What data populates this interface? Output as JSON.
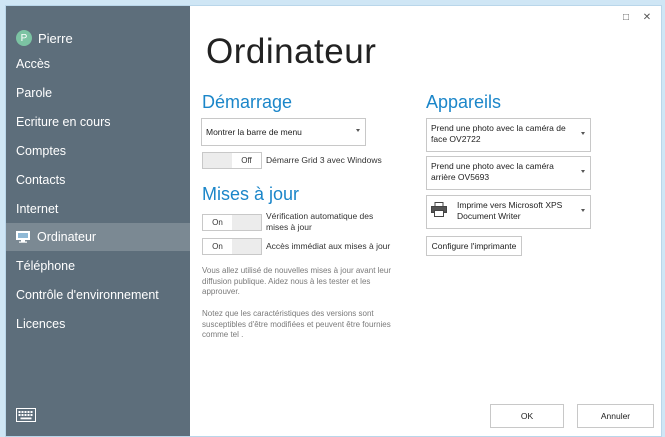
{
  "user": {
    "initial": "P",
    "name": "Pierre"
  },
  "sidebar": {
    "items": [
      {
        "label": "Accès"
      },
      {
        "label": "Parole"
      },
      {
        "label": "Ecriture en cours"
      },
      {
        "label": "Comptes"
      },
      {
        "label": "Contacts"
      },
      {
        "label": "Internet"
      },
      {
        "label": "Ordinateur",
        "active": true,
        "icon": "monitor-icon"
      },
      {
        "label": "Téléphone"
      },
      {
        "label": "Contrôle d'environnement"
      },
      {
        "label": "Licences"
      }
    ],
    "bottom_icon": "keyboard-icon"
  },
  "window_controls": {
    "maximize": "□",
    "close": "✕"
  },
  "page": {
    "title": "Ordinateur"
  },
  "startup": {
    "title": "Démarrage",
    "menu_dropdown": "Montrer la barre de menu",
    "toggle": {
      "on": "",
      "off": "Off"
    },
    "toggle_label": "Démarre Grid 3 avec Windows"
  },
  "updates": {
    "title": "Mises à jour",
    "auto_check": {
      "on": "On",
      "label": "Vérification automatique des mises à jour"
    },
    "immediate": {
      "on": "On",
      "label": "Accès immédiat aux mises à jour"
    },
    "note1": "Vous allez utilisé de nouvelles mises à jour avant leur diffusion publique. Aidez nous à  les tester et les approuver.",
    "note2": "Notez que les caractéristiques des versions sont susceptibles d'être modifiées et peuvent être fournies comme tel ."
  },
  "devices": {
    "title": "Appareils",
    "front_camera": "Prend une photo avec la caméra de face OV2722",
    "rear_camera": "Prend une photo avec la caméra arrière OV5693",
    "printer": "Imprime vers Microsoft XPS Document Writer",
    "configure_printer": "Configure l'imprimante"
  },
  "footer": {
    "ok": "OK",
    "cancel": "Annuler"
  },
  "colors": {
    "sidebar": "#5d6e7b",
    "sidebar_active": "#7b8993",
    "accent": "#1b86c9",
    "avatar": "#7cc3a3"
  }
}
